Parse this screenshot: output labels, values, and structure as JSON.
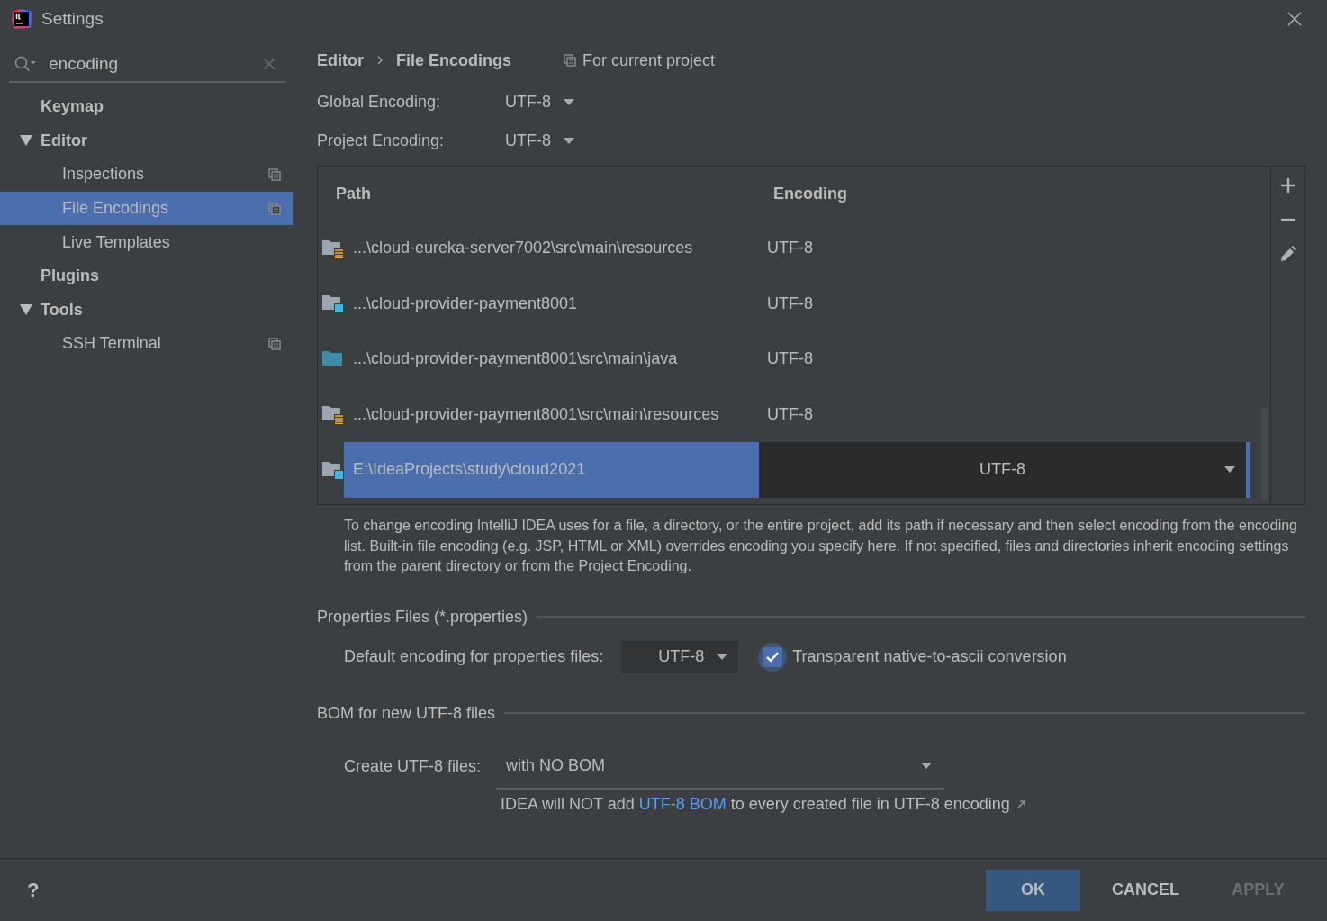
{
  "window": {
    "title": "Settings"
  },
  "search": {
    "value": "encoding"
  },
  "sidebar": {
    "items": [
      {
        "label": "Keymap",
        "bold": true,
        "project_icon": false,
        "selected": false
      },
      {
        "label": "Editor",
        "bold": true,
        "project_icon": false,
        "selected": false,
        "expanded": true,
        "children": [
          {
            "label": "Inspections",
            "bold": false,
            "project_icon": true,
            "selected": false
          },
          {
            "label": "File Encodings",
            "bold": false,
            "project_icon": true,
            "selected": true
          },
          {
            "label": "Live Templates",
            "bold": false,
            "project_icon": false,
            "selected": false
          }
        ]
      },
      {
        "label": "Plugins",
        "bold": true,
        "project_icon": false,
        "selected": false
      },
      {
        "label": "Tools",
        "bold": true,
        "project_icon": false,
        "selected": false,
        "expanded": true,
        "children": [
          {
            "label": "SSH Terminal",
            "bold": false,
            "project_icon": true,
            "selected": false
          }
        ]
      }
    ]
  },
  "breadcrumb": {
    "items": [
      "Editor",
      "File Encodings"
    ],
    "scope": "For current project"
  },
  "global_encoding": {
    "label": "Global Encoding:",
    "value": "UTF-8"
  },
  "project_encoding": {
    "label": "Project Encoding:",
    "value": "UTF-8"
  },
  "table": {
    "columns": [
      "Path",
      "Encoding"
    ],
    "rows": [
      {
        "kind": "resources",
        "path": "...\\cloud-eureka-server7002\\src\\main\\resources",
        "encoding": "UTF-8",
        "selected": false
      },
      {
        "kind": "module",
        "path": "...\\cloud-provider-payment8001",
        "encoding": "UTF-8",
        "selected": false
      },
      {
        "kind": "source",
        "path": "...\\cloud-provider-payment8001\\src\\main\\java",
        "encoding": "UTF-8",
        "selected": false
      },
      {
        "kind": "resources",
        "path": "...\\cloud-provider-payment8001\\src\\main\\resources",
        "encoding": "UTF-8",
        "selected": false
      },
      {
        "kind": "module",
        "path": "E:\\IdeaProjects\\study\\cloud2021",
        "encoding": "UTF-8",
        "selected": true
      }
    ]
  },
  "description": "To change encoding IntelliJ IDEA uses for a file, a directory, or the entire project, add its path if necessary and then select encoding from the encoding list. Built-in file encoding (e.g. JSP, HTML or XML) overrides encoding you specify here. If not specified, files and directories inherit encoding settings from the parent directory or from the Project Encoding.",
  "properties_section": {
    "title": "Properties Files (*.properties)",
    "label": "Default encoding for properties files:",
    "value": "UTF-8",
    "checkbox": {
      "label": "Transparent native-to-ascii conversion",
      "checked": true
    }
  },
  "bom_section": {
    "title": "BOM for new UTF-8 files",
    "label": "Create UTF-8 files:",
    "value": "with NO BOM",
    "hint": {
      "before": "IDEA will NOT add ",
      "link": "UTF-8 BOM",
      "after": " to every created file in UTF-8 encoding"
    }
  },
  "footer": {
    "help": "?",
    "buttons": [
      {
        "label": "OK",
        "kind": "default",
        "disabled": false
      },
      {
        "label": "CANCEL",
        "kind": "normal",
        "disabled": false
      },
      {
        "label": "APPLY",
        "kind": "normal",
        "disabled": true
      }
    ]
  }
}
